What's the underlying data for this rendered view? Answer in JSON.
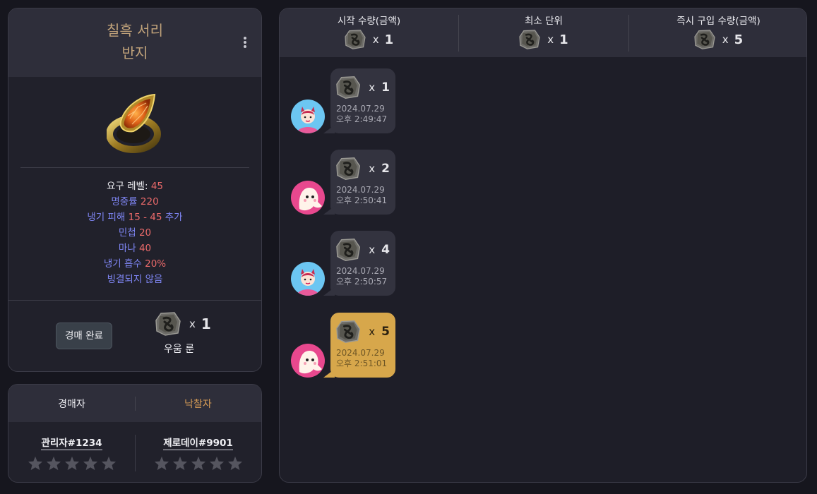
{
  "item": {
    "name_line1": "칠흑 서리",
    "name_line2": "반지",
    "stats": {
      "req_level_label": "요구 레벨:",
      "req_level_value": "45",
      "accuracy_label": "명중률",
      "accuracy_value": "220",
      "cold_label": "냉기 피해",
      "cold_value": "15 - 45",
      "cold_suffix": "추가",
      "dex_label": "민첩",
      "dex_value": "20",
      "mana_label": "마나",
      "mana_value": "40",
      "cold_absorb_label": "냉기 흡수",
      "cold_absorb_value": "20%",
      "cbf": "빙결되지 않음"
    },
    "complete_button": "경매 완료",
    "price": {
      "x": "x",
      "qty": "1",
      "rune_name": "우움 룬"
    }
  },
  "parties": {
    "seller_label": "경매자",
    "winner_label": "낙찰자",
    "seller_name": "관리자#1234",
    "winner_name": "제로데이#9901",
    "seller_rating": 0,
    "winner_rating": 0,
    "max_rating": 5
  },
  "summary": {
    "start_label": "시작 수량(금액)",
    "start_qty": "1",
    "min_label": "최소 단위",
    "min_qty": "1",
    "buyout_label": "즉시 구입 수량(금액)",
    "buyout_qty": "5",
    "x": "x"
  },
  "bids": [
    {
      "qty": "1",
      "date": "2024.07.29",
      "time": "오후 2:49:47",
      "avatar": "devil-avatar",
      "winning": false
    },
    {
      "qty": "2",
      "date": "2024.07.29",
      "time": "오후 2:50:41",
      "avatar": "ghost-avatar",
      "winning": false
    },
    {
      "qty": "4",
      "date": "2024.07.29",
      "time": "오후 2:50:57",
      "avatar": "devil-avatar",
      "winning": false
    },
    {
      "qty": "5",
      "date": "2024.07.29",
      "time": "오후 2:51:01",
      "avatar": "ghost-avatar",
      "winning": true
    }
  ],
  "colors": {
    "item_name": "#c0a27a",
    "magic_blue": "#7f86f5",
    "value_red": "#eb6a6a",
    "winner_orange": "#d59b55",
    "winning_bid": "#d7a74b"
  }
}
